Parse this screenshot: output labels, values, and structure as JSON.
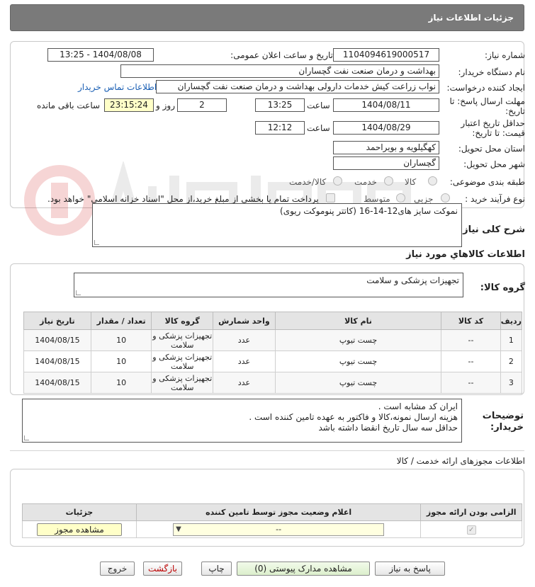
{
  "header": {
    "title": "جزئیات اطلاعات نیاز"
  },
  "form": {
    "need_number_label": "شماره نیاز:",
    "need_number": "1104094619000517",
    "announce_label": "تاریخ و ساعت اعلان عمومی:",
    "announce_value": "1404/08/08 - 13:25",
    "buyer_label": "نام دستگاه خریدار:",
    "buyer_value": "بهداشت و درمان صنعت نفت گچساران",
    "creator_label": "ایجاد کننده درخواست:",
    "creator_value": "نواب زراعت کیش خدمات دارولی بهداشت و درمان صنعت نفت گچساران",
    "contact_link": "اطلاعات تماس خریدار",
    "deadline_label": "مهلت ارسال پاسخ: تا تاریخ:",
    "deadline_date": "1404/08/11",
    "time_label": "ساعت",
    "deadline_time": "13:25",
    "days_value": "2",
    "days_label": "روز و",
    "remaining_time": "23:15:24",
    "remaining_label": "ساعت باقی مانده",
    "validity_label": "حداقل تاریخ اعتبار قیمت: تا تاریخ:",
    "validity_date": "1404/08/29",
    "validity_time_label": "ساعت",
    "validity_time": "12:12",
    "province_label": "استان محل تحویل:",
    "province_value": "کهگیلویه و بویراحمد",
    "city_label": "شهر محل تحویل:",
    "city_value": "گچساران",
    "category_label": "طبقه بندی موضوعی:",
    "category_options": [
      "کالا",
      "خدمت",
      "کالا/خدمت"
    ],
    "process_label": "نوع فرآیند خرید :",
    "process_options": [
      "جزیی",
      "متوسط"
    ],
    "payment_note": "پرداخت تمام یا بخشی از مبلغ خرید،از محل \"اسناد خزانه اسلامی\" خواهد بود."
  },
  "summary": {
    "label": "شرح کلی نیاز:",
    "value": "نموکت  سایز های12-14-16 (کاتتر پنوموکت ریوی)"
  },
  "goods_info": {
    "heading": "اطلاعات کالاهاي مورد نياز",
    "group_label": "گروه کالا:",
    "group_value": "تجهیزات پزشکی و سلامت"
  },
  "items_table": {
    "headers": [
      "ردیف",
      "کد کالا",
      "نام کالا",
      "واحد شمارش",
      "گروه کالا",
      "تعداد / مقدار",
      "تاریخ نیاز"
    ],
    "rows": [
      {
        "row": "1",
        "code": "--",
        "name": "چست تیوپ",
        "unit": "عدد",
        "group": "تجهیزات پزشکی و سلامت",
        "qty": "10",
        "date": "1404/08/15"
      },
      {
        "row": "2",
        "code": "--",
        "name": "چست تیوپ",
        "unit": "عدد",
        "group": "تجهیزات پزشکی و سلامت",
        "qty": "10",
        "date": "1404/08/15"
      },
      {
        "row": "3",
        "code": "--",
        "name": "چست تیوپ",
        "unit": "عدد",
        "group": "تجهیزات پزشکی و سلامت",
        "qty": "10",
        "date": "1404/08/15"
      }
    ]
  },
  "buyer_notes": {
    "label": "توضیحات خریدار:",
    "lines": [
      "ایران کد مشابه است .",
      "هزینه ارسال نمونه،کالا و فاکتور به عهده تامین کننده است .",
      "حداقل سه سال تاریخ انقضا داشته باشد"
    ]
  },
  "permits": {
    "heading": "اطلاعات مجوزهای ارائه خدمت / کالا",
    "headers": [
      "الزامی بودن ارائه مجوز",
      "اعلام وضعیت مجوز توسط تامین کننده",
      "جزئیات"
    ],
    "select_value": "--",
    "view_button": "مشاهده مجوز"
  },
  "actions": {
    "reply": "پاسخ به نیاز",
    "attachments": "مشاهده مدارک پیوستی (0)",
    "print": "چاپ",
    "back": "بازگشت",
    "exit": "خروج"
  },
  "colors": {
    "header_bg": "#7a7a7a",
    "link": "#1a5fb4",
    "highlight": "#ffffc8"
  }
}
